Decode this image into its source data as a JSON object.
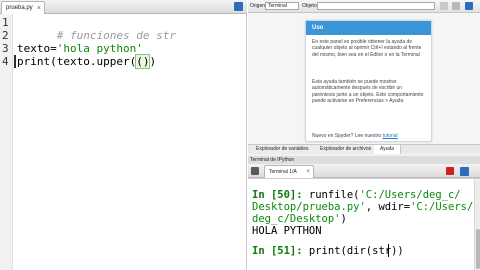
{
  "editor": {
    "tab_label": "prueba.py",
    "tab_close": "×",
    "line_numbers": [
      "1",
      "2",
      "3",
      "4"
    ],
    "line1_comment": "# funciones de str",
    "line3_var": "texto=",
    "line3_str": "'hola python'",
    "line4_func": "print(texto.upper(",
    "line4_paren": "()",
    "line4_end": ")"
  },
  "help": {
    "origin_label": "Origen",
    "origin_value": "Terminal",
    "object_label": "Objeto",
    "card_title": "Uso",
    "para1": "En este panel es posible obtener la ayuda de cualquier objeto al oprimir Ctrl+I estando al frente del mismo, bien sea en el Editor o en la Terminal",
    "para2": "Esta ayuda también se puede mostrar automáticamente después de escribir un paréntesis junto a un objeto. Este comportamiento puede activarse en Preferencias > Ayuda",
    "footer_text": "Nuevo en Spyder? Lee nuestro",
    "footer_link": "tutorial"
  },
  "bottom_tabs": {
    "variables": "Explorador de variables",
    "files": "Explorador de archivos",
    "help": "Ayuda"
  },
  "console": {
    "title": "Terminal de IPython",
    "tab_label": "Terminal 1/A",
    "tab_close": "×",
    "in50_prompt": "In [50]: ",
    "in50_l1_a": "runfile(",
    "in50_l1_str": "'C:/Users/deg_c/",
    "in50_l2_str": "Desktop/prueba.py'",
    "in50_l2_b": ", wdir=",
    "in50_l2_str2": "'C:/Users/",
    "in50_l3_str": "deg_c/Desktop'",
    "in50_l3_b": ")",
    "output": "HOLA PYTHON",
    "in51_prompt": "In [51]: ",
    "in51_code": "print(dir(str))"
  },
  "colors": {
    "help_header": "#3a96d8",
    "string_green": "#0a8a0a",
    "prompt_green": "#0a7a0a"
  }
}
